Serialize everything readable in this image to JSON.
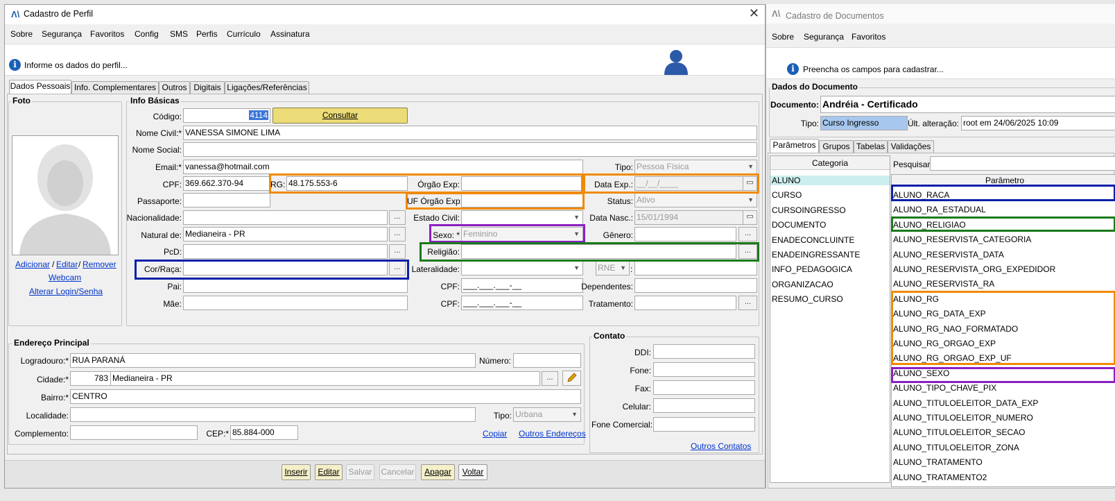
{
  "w1": {
    "title": "Cadastro de Perfil",
    "menu": [
      "Sobre",
      "Segurança",
      "Favoritos",
      "Config",
      "SMS",
      "Perfis",
      "Currículo",
      "Assinatura"
    ],
    "info": "Informe os dados do perfil...",
    "tabs": [
      "Dados Pessoais",
      "Info. Complementares",
      "Outros",
      "Digitais",
      "Ligações/Referências"
    ]
  },
  "foto": {
    "group": "Foto",
    "adicionar": "Adicionar",
    "editar": "Editar",
    "remover": "Remover",
    "sep": "/",
    "webcam": "Webcam",
    "alterar": "Alterar Login/Senha"
  },
  "info": {
    "group": "Info Básicas",
    "codigo": {
      "label": "Código:",
      "value": "4114",
      "btn": "Consultar"
    },
    "nome_civil": {
      "label": "Nome Civil:*",
      "value": "VANESSA SIMONE LIMA"
    },
    "nome_social": {
      "label": "Nome Social:",
      "value": ""
    },
    "email": {
      "label": "Email:*",
      "value": "vanessa@hotmail.com"
    },
    "tipo": {
      "label": "Tipo:",
      "value": "Pessoa Física"
    },
    "cpf": {
      "label": "CPF:",
      "value": "369.662.370-94"
    },
    "rg": {
      "label": "RG:",
      "value": "48.175.553-6"
    },
    "orgao_exp": {
      "label": "Órgão Exp:",
      "value": ""
    },
    "data_exp": {
      "label": "Data Exp.:",
      "value": "__/__/____"
    },
    "passaporte": {
      "label": "Passaporte:",
      "value": ""
    },
    "uf_orgao": {
      "label": "UF Órgão Exp:",
      "value": ""
    },
    "status": {
      "label": "Status:",
      "value": "Ativo"
    },
    "nacionalidade": {
      "label": "Nacionalidade:",
      "value": ""
    },
    "estado_civil": {
      "label": "Estado Civil:",
      "value": ""
    },
    "data_nasc": {
      "label": "Data Nasc.:",
      "value": "15/01/1994"
    },
    "natural": {
      "label": "Natural de:",
      "value": "Medianeira - PR"
    },
    "sexo": {
      "label": "Sexo: *",
      "value": "Feminino"
    },
    "genero": {
      "label": "Gênero:",
      "value": ""
    },
    "pcd": {
      "label": "PcD:",
      "value": ""
    },
    "religiao": {
      "label": "Religião:",
      "value": ""
    },
    "cor": {
      "label": "Cor/Raça:",
      "value": ""
    },
    "lateralidade": {
      "label": "Lateralidade:",
      "value": ""
    },
    "rne": {
      "value": "RNE",
      "colon": ":"
    },
    "pai": {
      "label": "Pai:",
      "value": ""
    },
    "cpf_pai": {
      "label": "CPF:",
      "value": "___.___.___-__"
    },
    "dependentes": {
      "label": "Dependentes:",
      "value": ""
    },
    "mae": {
      "label": "Mãe:",
      "value": ""
    },
    "cpf_mae": {
      "label": "CPF:",
      "value": "___.___.___-__"
    },
    "tratamento": {
      "label": "Tratamento:",
      "value": ""
    },
    "ellipsis": "..."
  },
  "end": {
    "group": "Endereço Principal",
    "logradouro": {
      "label": "Logradouro:*",
      "value": "RUA PARANÁ"
    },
    "numero": {
      "label": "Número:",
      "value": ""
    },
    "cidade": {
      "label": "Cidade:*",
      "code": "783",
      "value": "Medianeira - PR"
    },
    "bairro": {
      "label": "Bairro:*",
      "value": "CENTRO"
    },
    "localidade": {
      "label": "Localidade:",
      "value": ""
    },
    "tipo": {
      "label": "Tipo:",
      "value": "Urbana"
    },
    "complemento": {
      "label": "Complemento:",
      "value": ""
    },
    "cep": {
      "label": "CEP:*",
      "value": "85.884-000"
    },
    "copiar": "Copiar",
    "outros": "Outros Endereços"
  },
  "contato": {
    "group": "Contato",
    "ddi": "DDI:",
    "fone": "Fone:",
    "fax": "Fax:",
    "celular": "Celular:",
    "comercial": "Fone Comercial:",
    "outros": "Outros Contatos"
  },
  "actions": [
    "Inserir",
    "Editar",
    "Salvar",
    "Cancelar",
    "Apagar",
    "Voltar"
  ],
  "w2": {
    "title": "Cadastro de Documentos",
    "menu": [
      "Sobre",
      "Segurança",
      "Favoritos"
    ],
    "info": "Preencha os campos para cadastrar...",
    "group": "Dados do Documento",
    "documento": {
      "label": "Documento:",
      "value": "Andréia - Certificado"
    },
    "tipo": {
      "label": "Tipo:",
      "value": "Curso Ingresso"
    },
    "ult": {
      "label": "Últ. alteração:",
      "value": "root em 24/06/2025 10:09"
    },
    "tabs": [
      "Parâmetros",
      "Grupos",
      "Tabelas",
      "Validações"
    ],
    "cat_header": "Categoria",
    "categorias": [
      "ALUNO",
      "CURSO",
      "CURSOINGRESSO",
      "DOCUMENTO",
      "ENADECONCLUINTE",
      "ENADEINGRESSANTE",
      "INFO_PEDAGOGICA",
      "ORGANIZACAO",
      "RESUMO_CURSO"
    ],
    "pesquisar": "Pesquisar:",
    "param_header": "Parâmetro",
    "parametros": [
      "ALUNO_RACA",
      "ALUNO_RA_ESTADUAL",
      "ALUNO_RELIGIAO",
      "ALUNO_RESERVISTA_CATEGORIA",
      "ALUNO_RESERVISTA_DATA",
      "ALUNO_RESERVISTA_ORG_EXPEDIDOR",
      "ALUNO_RESERVISTA_RA",
      "ALUNO_RG",
      "ALUNO_RG_DATA_EXP",
      "ALUNO_RG_NAO_FORMATADO",
      "ALUNO_RG_ORGAO_EXP",
      "ALUNO_RG_ORGAO_EXP_UF",
      "ALUNO_SEXO",
      "ALUNO_TIPO_CHAVE_PIX",
      "ALUNO_TITULOELEITOR_DATA_EXP",
      "ALUNO_TITULOELEITOR_NUMERO",
      "ALUNO_TITULOELEITOR_SECAO",
      "ALUNO_TITULOELEITOR_ZONA",
      "ALUNO_TRATAMENTO",
      "ALUNO_TRATAMENTO2"
    ]
  },
  "colors": {
    "orange": "#f08a00",
    "blue": "#0a1fa8",
    "green": "#1a7a1a",
    "purple": "#8a1fc2",
    "selection": "#3a75d8",
    "category_selected": "#cdeeee"
  }
}
